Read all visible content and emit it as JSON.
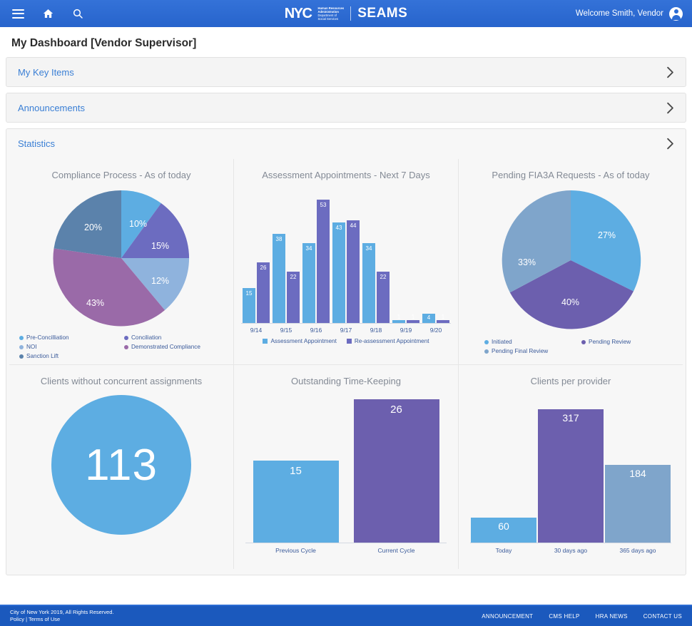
{
  "topbar": {
    "menu_icon": "hamburger-icon",
    "home_icon": "home-icon",
    "search_icon": "search-icon",
    "brand_nyc": "NYC",
    "brand_agency_line1": "Human Resources",
    "brand_agency_line2": "Administration",
    "brand_agency_line3": "Department of",
    "brand_agency_line4": "Social Services",
    "app_name": "SEAMS",
    "welcome": "Welcome Smith, Vendor",
    "avatar_icon": "user-avatar-icon",
    "background_color": "#2b6cd4"
  },
  "page": {
    "title": "My Dashboard [Vendor Supervisor]"
  },
  "panels": [
    {
      "label": "My Key Items",
      "expanded": false
    },
    {
      "label": "Announcements",
      "expanded": false
    },
    {
      "label": "Statistics",
      "expanded": true
    }
  ],
  "chart_data": [
    {
      "type": "pie",
      "title": "Compliance Process - As of today",
      "categories": [
        "Pre-Concilliation",
        "Conciliation",
        "NOI",
        "Demonstrated Compliance",
        "Sanction Lift"
      ],
      "values": [
        10,
        15,
        12,
        43,
        20
      ],
      "labels": [
        "10%",
        "15%",
        "12%",
        "43%",
        "20%"
      ],
      "colors": [
        "#5dade2",
        "#6c6cc0",
        "#8fb3dd",
        "#9a6aa8",
        "#5b82ab"
      ],
      "legend_position": "bottom",
      "legend": [
        {
          "label": "Pre-Concilliation",
          "color": "#5dade2"
        },
        {
          "label": "Conciliation",
          "color": "#6c6cc0"
        },
        {
          "label": "NOI",
          "color": "#8fb3dd"
        },
        {
          "label": "Demonstrated Compliance",
          "color": "#9a6aa8"
        },
        {
          "label": "Sanction Lift",
          "color": "#5b82ab"
        }
      ]
    },
    {
      "type": "bar",
      "title": "Assessment Appointments - Next 7 Days",
      "categories": [
        "9/14",
        "9/15",
        "9/16",
        "9/17",
        "9/18",
        "9/19",
        "9/20"
      ],
      "series": [
        {
          "name": "Assessment Appointment",
          "color": "#5dade2",
          "values": [
            15,
            38,
            34,
            43,
            34,
            1,
            4
          ]
        },
        {
          "name": "Re-assessment Appointment",
          "color": "#6c6cc0",
          "values": [
            26,
            22,
            53,
            44,
            22,
            1,
            1
          ]
        }
      ],
      "ylim": [
        0,
        58
      ],
      "grid": false,
      "legend_position": "bottom",
      "xlabel": "",
      "ylabel": ""
    },
    {
      "type": "pie",
      "title": "Pending FIA3A Requests - As of today",
      "categories": [
        "Initiated",
        "Pending Review",
        "Pending Final Review"
      ],
      "values": [
        27,
        40,
        33
      ],
      "labels": [
        "27%",
        "40%",
        "33%"
      ],
      "colors": [
        "#5dade2",
        "#6c5fae",
        "#7fa5cb"
      ],
      "legend_position": "bottom",
      "legend": [
        {
          "label": "Initiated",
          "color": "#5dade2"
        },
        {
          "label": "Pending Review",
          "color": "#6c5fae"
        },
        {
          "label": "Pending Final Review",
          "color": "#7fa5cb"
        }
      ]
    },
    {
      "type": "bar",
      "title": "Clients without concurrent assignments",
      "categories": [
        "Clients without concurrent assignments"
      ],
      "values": [
        113
      ],
      "display": "single-value-circle",
      "value_label": "113",
      "colors": [
        "#5dade2"
      ]
    },
    {
      "type": "bar",
      "title": "Outstanding Time-Keeping",
      "categories": [
        "Previous Cycle",
        "Current Cycle"
      ],
      "values": [
        15,
        26
      ],
      "colors": [
        "#5dade2",
        "#6c5fae"
      ],
      "ylim": [
        0,
        28
      ],
      "grid": false
    },
    {
      "type": "bar",
      "title": "Clients per provider",
      "categories": [
        "Today",
        "30 days ago",
        "365 days ago"
      ],
      "values": [
        60,
        317,
        184
      ],
      "colors": [
        "#5dade2",
        "#6c5fae",
        "#7fa5cb"
      ],
      "ylim": [
        0,
        350
      ],
      "grid": false
    }
  ],
  "footer": {
    "copyright": "City of New York 2019, All Rights Reserved.",
    "policy": "Policy | Terms of Use",
    "links": [
      "ANNOUNCEMENT",
      "CMS HELP",
      "HRA NEWS",
      "CONTACT US"
    ],
    "background_color": "#1b59bd"
  }
}
